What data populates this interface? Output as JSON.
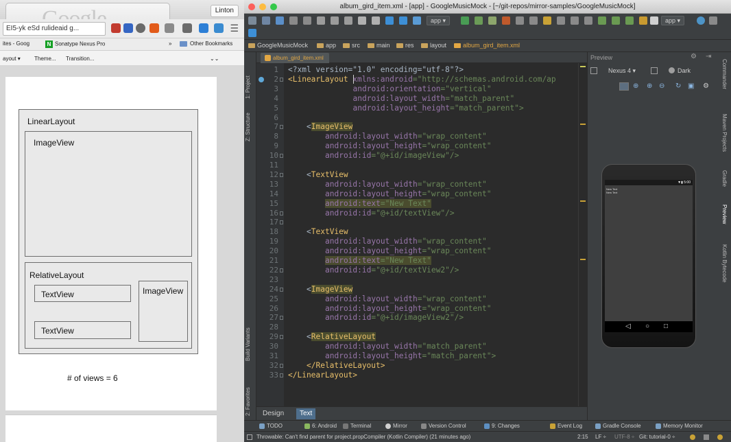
{
  "browser": {
    "tab_logo_text": "Google",
    "profile_button": "Linton",
    "url_text": "EI5-yk  eSd rulideaid g...",
    "bookmarks": [
      {
        "label": "ites - Goog"
      },
      {
        "label": "Sonatype Nexus Pro"
      },
      {
        "label": "Other Bookmarks"
      }
    ],
    "bookmarks_overflow": "»",
    "page_toolbar": [
      "ayout ▾",
      "Theme...",
      "Transition..."
    ],
    "page_toolbar_overflow": "⌄⌄",
    "diagram": {
      "linear_layout": "LinearLayout",
      "image_view_top": "ImageView",
      "relative_layout": "RelativeLayout",
      "text_view_1": "TextView",
      "text_view_2": "TextView",
      "image_view_side": "ImageView"
    },
    "view_count": "# of views = 6"
  },
  "ide": {
    "title": "album_gird_item.xml - [app] - GoogleMusicMock - [~/git-repos/mirror-samples/GoogleMusicMock]",
    "toolbar": {
      "run_config": "app ▾",
      "device_config": "app ▾"
    },
    "breadcrumbs": [
      "GoogleMusicMock",
      "app",
      "src",
      "main",
      "res",
      "layout",
      "album_gird_item.xml"
    ],
    "file_tab": "album_gird_item.xml",
    "left_tools": [
      "1: Project",
      "Z: Structure",
      "Build Variants",
      "2: Favorites"
    ],
    "line_numbers": [
      "1",
      "2",
      "3",
      "4",
      "5",
      "6",
      "7",
      "8",
      "9",
      "10",
      "11",
      "12",
      "13",
      "14",
      "15",
      "16",
      "17",
      "18",
      "19",
      "20",
      "21",
      "22",
      "23",
      "24",
      "25",
      "26",
      "27",
      "28",
      "29",
      "30",
      "31",
      "32",
      "33"
    ],
    "code": {
      "l1": "<?xml version=\"1.0\" encoding=\"utf-8\"?>",
      "l2_tag": "<LinearLayout",
      "l2_attr": " xmlns:android",
      "l2_val": "=\"http://schemas.android.com/ap",
      "l3_attr": "android:orientation",
      "l3_val": "=\"vertical\"",
      "l4_attr": "android:layout_width",
      "l4_val": "=\"match_parent\"",
      "l5_attr": "android:layout_height",
      "l5_val": "=\"match_parent\">",
      "l7_tag": "ImageView",
      "l8_val": "=\"wrap_content\"",
      "l9_val": "=\"wrap_content\"",
      "l10_val": "=\"@+id/imageView\"/>",
      "l12_tag": "TextView",
      "l13_val": "=\"wrap_content\"",
      "l14_val": "=\"wrap_content\"",
      "l15_attr": "android:text",
      "l15_val": "=\"New Text\"",
      "l16_val": "=\"@+id/textView\"/>",
      "l17_tag": "TextView",
      "l19_val": "=\"wrap_content\"",
      "l20_val": "=\"wrap_content\"",
      "l21_val": "=\"New Text\"",
      "l22_val": "=\"@+id/textView2\"/>",
      "l24_tag": "ImageView",
      "l25_val": "=\"wrap_content\"",
      "l26_val": "=\"wrap_content\"",
      "l27_val": "=\"@+id/imageView2\"/>",
      "l29_tag": "RelativeLayout",
      "l30_val": "=\"match_parent\"",
      "l31_val": "=\"match_parent\">",
      "l32": "</RelativeLayout>",
      "l33": "</LinearLayout>",
      "attr_width": "android:layout_width",
      "attr_height": "android:layout_height",
      "attr_id": "android:id",
      "lt": "<"
    },
    "design_tabs": [
      "Design",
      "Text"
    ],
    "preview": {
      "header": "Preview",
      "device": "Nexus 4 ▾",
      "theme": "Dark",
      "phone_time": "5:00",
      "phone_text_1": "New Text",
      "phone_text_2": "New Text"
    },
    "right_tools": [
      "Commander",
      "Maven Projects",
      "Gradle",
      "Preview",
      "Kotlin Bytecode"
    ],
    "tool_windows": [
      "TODO",
      "6: Android",
      "Terminal",
      "Mirror",
      "Version Control",
      "9: Changes",
      "Event Log",
      "Gradle Console",
      "Memory Monitor"
    ],
    "status": {
      "message": "Throwable: Can't find parent for project.propCompiler (Kotlin Compiler) (21 minutes ago)",
      "position": "2:15",
      "line_sep": "LF ÷",
      "encoding": "UTF-8 ÷",
      "vcs": "Git: tutorial-0 ÷"
    }
  },
  "colors": {
    "tag": "#e8bf6a",
    "attr": "#9876aa",
    "value": "#6a8759",
    "editor_bg": "#2b2b2b",
    "chrome_bg": "#3c3f41"
  }
}
